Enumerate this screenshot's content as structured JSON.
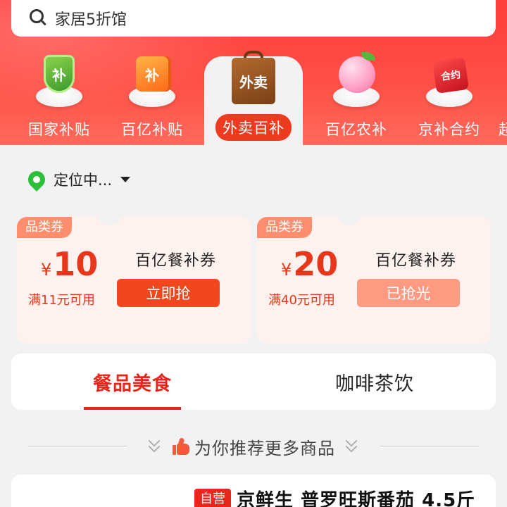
{
  "search": {
    "text": "家居5折馆"
  },
  "categories": [
    {
      "label": "国家补贴",
      "icon": "shield-subsidy-icon",
      "icon_text": "补"
    },
    {
      "label": "百亿补贴",
      "icon": "orange-box-subsidy-icon",
      "icon_text": "补"
    },
    {
      "label": "外卖百补",
      "icon": "takeout-bag-icon",
      "icon_text": "外卖",
      "active": true
    },
    {
      "label": "百亿农补",
      "icon": "lychee-icon"
    },
    {
      "label": "京补合约",
      "icon": "red-tag-contract-icon",
      "icon_text": "合约"
    },
    {
      "label": "超"
    }
  ],
  "location": {
    "text": "定位中..."
  },
  "coupons": [
    {
      "badge": "品类券",
      "currency": "¥",
      "amount": "10",
      "condition": "满11元可用",
      "title": "百亿餐补券",
      "button": "立即抢",
      "state": "available"
    },
    {
      "badge": "品类券",
      "currency": "¥",
      "amount": "20",
      "condition": "满40元可用",
      "title": "百亿餐补券",
      "button": "已抢光",
      "state": "sold-out"
    }
  ],
  "tabs": [
    {
      "label": "餐品美食",
      "active": true
    },
    {
      "label": "咖啡茶饮",
      "active": false
    }
  ],
  "recommend": {
    "text": "为你推荐更多商品"
  },
  "product": {
    "badge": "自营",
    "title": "京鲜生 普罗旺斯番茄 4.5斤"
  },
  "colors": {
    "brand_red": "#e8261b",
    "coupon_bg": "#fff1ee",
    "location_green": "#2bbf3a"
  }
}
